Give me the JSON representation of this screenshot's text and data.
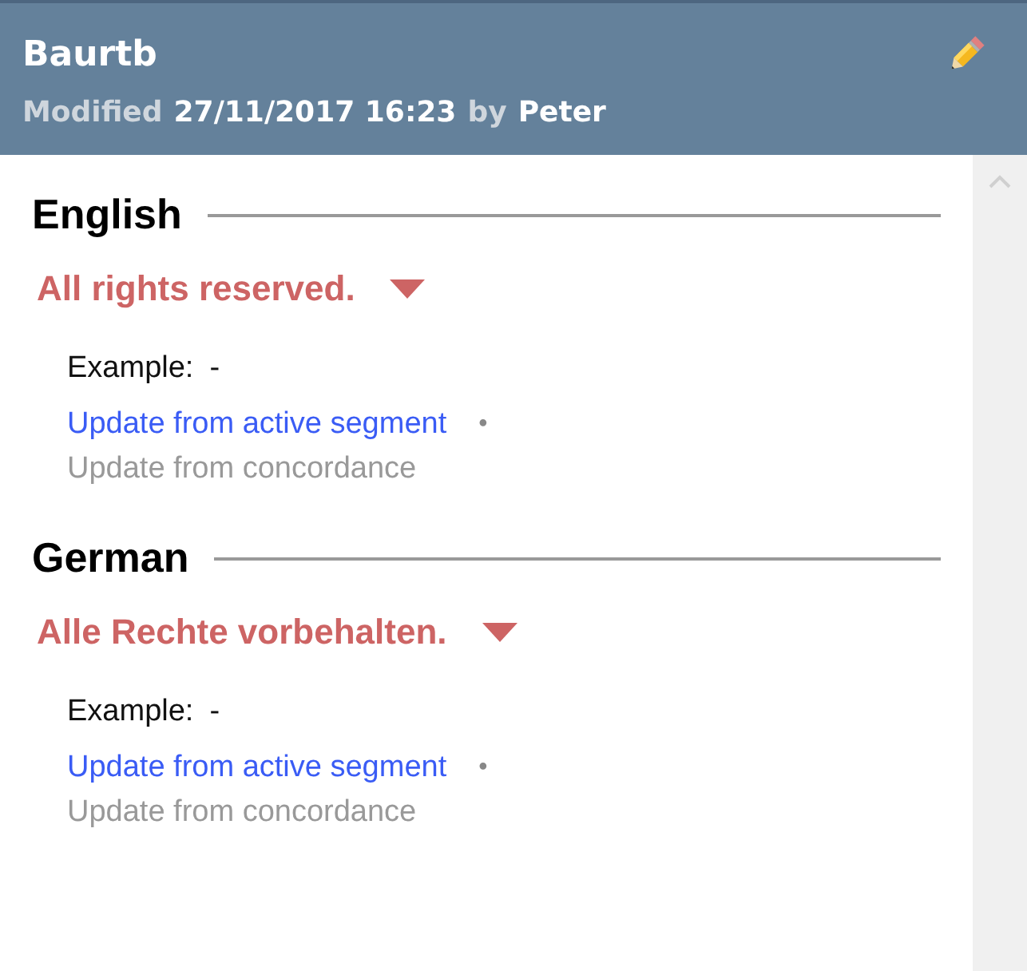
{
  "header": {
    "title": "Baurtb",
    "modified_label": "Modified",
    "modified_date": "27/11/2017 16:23",
    "by_label": "by",
    "author": "Peter"
  },
  "languages": [
    {
      "name": "English",
      "term": "All rights reserved.",
      "example_label": "Example:",
      "example_value": "-",
      "actions": [
        {
          "label": "Update from active segment",
          "disabled": false
        },
        {
          "label": "Update from concordance",
          "disabled": true
        }
      ],
      "separator": "•"
    },
    {
      "name": "German",
      "term": "Alle Rechte vorbehalten.",
      "example_label": "Example:",
      "example_value": "-",
      "actions": [
        {
          "label": "Update from active segment",
          "disabled": false
        },
        {
          "label": "Update from concordance",
          "disabled": true
        }
      ],
      "separator": "•"
    }
  ]
}
